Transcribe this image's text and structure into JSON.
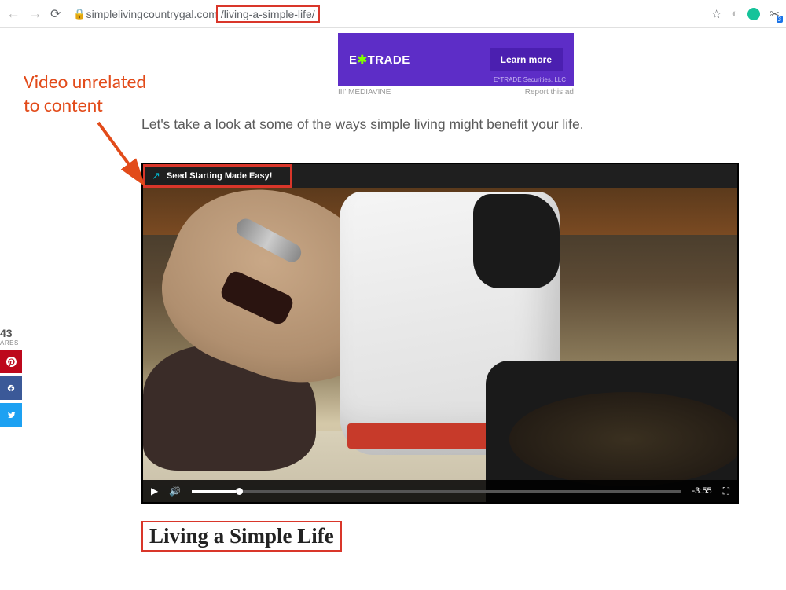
{
  "browser": {
    "url_domain": "simplelivingcountrygal.com",
    "url_path": "/living-a-simple-life/",
    "ext_badge_count": "3"
  },
  "annotation": {
    "line1": "Video unrelated",
    "line2": "to content"
  },
  "ad": {
    "logo_pre": "E",
    "logo_star": "✱",
    "logo_post": "TRADE",
    "cta": "Learn more",
    "disclaimer": "E*TRADE Securities, LLC",
    "provider": "III' MEDIAVINE",
    "report": "Report this ad"
  },
  "article": {
    "paragraph": "Let's take a look at some of the ways simple living might benefit your life.",
    "heading": "Living a Simple Life"
  },
  "video": {
    "title": "Seed Starting Made Easy!",
    "time_remaining": "-3:55"
  },
  "share": {
    "count": "43",
    "label": "ARES"
  }
}
